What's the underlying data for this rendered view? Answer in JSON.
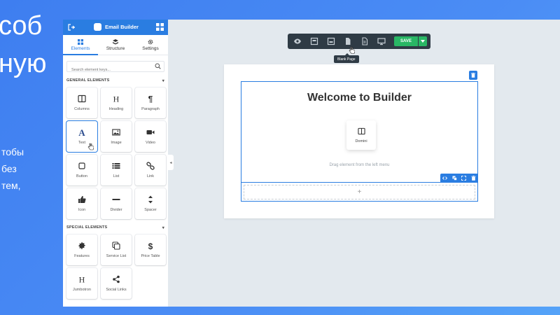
{
  "background_text": {
    "lines": [
      "соб",
      "ную",
      "тобы",
      "без",
      "тем,"
    ]
  },
  "sidebar": {
    "title": "Email Builder",
    "tabs": [
      {
        "label": "Elements",
        "icon": "grid-icon",
        "active": true
      },
      {
        "label": "Structure",
        "icon": "layers-icon",
        "active": false
      },
      {
        "label": "Settings",
        "icon": "gear-icon",
        "active": false
      }
    ],
    "search_placeholder": "Search element keys...",
    "general_heading": "GENERAL ELEMENTS",
    "general_items": [
      {
        "label": "Columns",
        "icon": "columns-icon"
      },
      {
        "label": "Heading",
        "icon": "heading-icon"
      },
      {
        "label": "Paragraph",
        "icon": "paragraph-icon"
      },
      {
        "label": "Text",
        "icon": "text-icon"
      },
      {
        "label": "Image",
        "icon": "image-icon"
      },
      {
        "label": "Video",
        "icon": "video-icon"
      },
      {
        "label": "Button",
        "icon": "button-icon"
      },
      {
        "label": "List",
        "icon": "list-icon"
      },
      {
        "label": "Link",
        "icon": "link-icon"
      },
      {
        "label": "Icon",
        "icon": "thumbs-up-icon"
      },
      {
        "label": "Divider",
        "icon": "divider-icon"
      },
      {
        "label": "Spacer",
        "icon": "spacer-icon"
      }
    ],
    "special_heading": "SPECIAL ELEMENTS",
    "special_items": [
      {
        "label": "Features",
        "icon": "gear-star-icon"
      },
      {
        "label": "Service List",
        "icon": "service-list-icon"
      },
      {
        "label": "Price Table",
        "icon": "dollar-icon"
      },
      {
        "label": "Jumbotron",
        "icon": "jumbotron-icon"
      },
      {
        "label": "Social Links",
        "icon": "share-icon"
      }
    ]
  },
  "toolbar": {
    "buttons": [
      "eye-icon",
      "archive-icon",
      "archive-down-icon",
      "blank-page-icon",
      "document-icon",
      "desktop-icon"
    ],
    "save_label": "SAVE",
    "tooltip": "Blank Page"
  },
  "canvas": {
    "heading": "Welcome to Builder",
    "dropped_element": "Domini",
    "drag_hint": "Drag element from the left menu",
    "add_row_symbol": "+"
  },
  "colors": {
    "accent": "#2a7de1",
    "save": "#29b765",
    "toolbar": "#2f3b45"
  }
}
